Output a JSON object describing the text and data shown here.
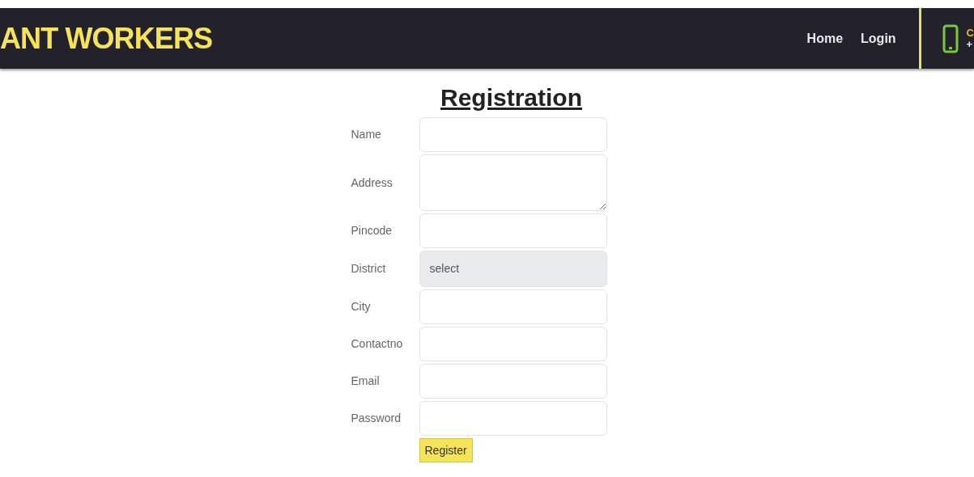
{
  "header": {
    "brand": "ANT WORKERS",
    "nav": [
      "Home",
      "Login"
    ],
    "contact": {
      "title": "C",
      "phone": "+"
    }
  },
  "form": {
    "title": "Registration",
    "fields": [
      {
        "label": "Name",
        "kind": "text"
      },
      {
        "label": "Address",
        "kind": "textarea"
      },
      {
        "label": "Pincode",
        "kind": "text"
      },
      {
        "label": "District",
        "kind": "select",
        "value": "select"
      },
      {
        "label": "City",
        "kind": "text"
      },
      {
        "label": "Contactno",
        "kind": "text"
      },
      {
        "label": "Email",
        "kind": "text"
      },
      {
        "label": "Password",
        "kind": "password"
      }
    ],
    "submit": "Register"
  }
}
